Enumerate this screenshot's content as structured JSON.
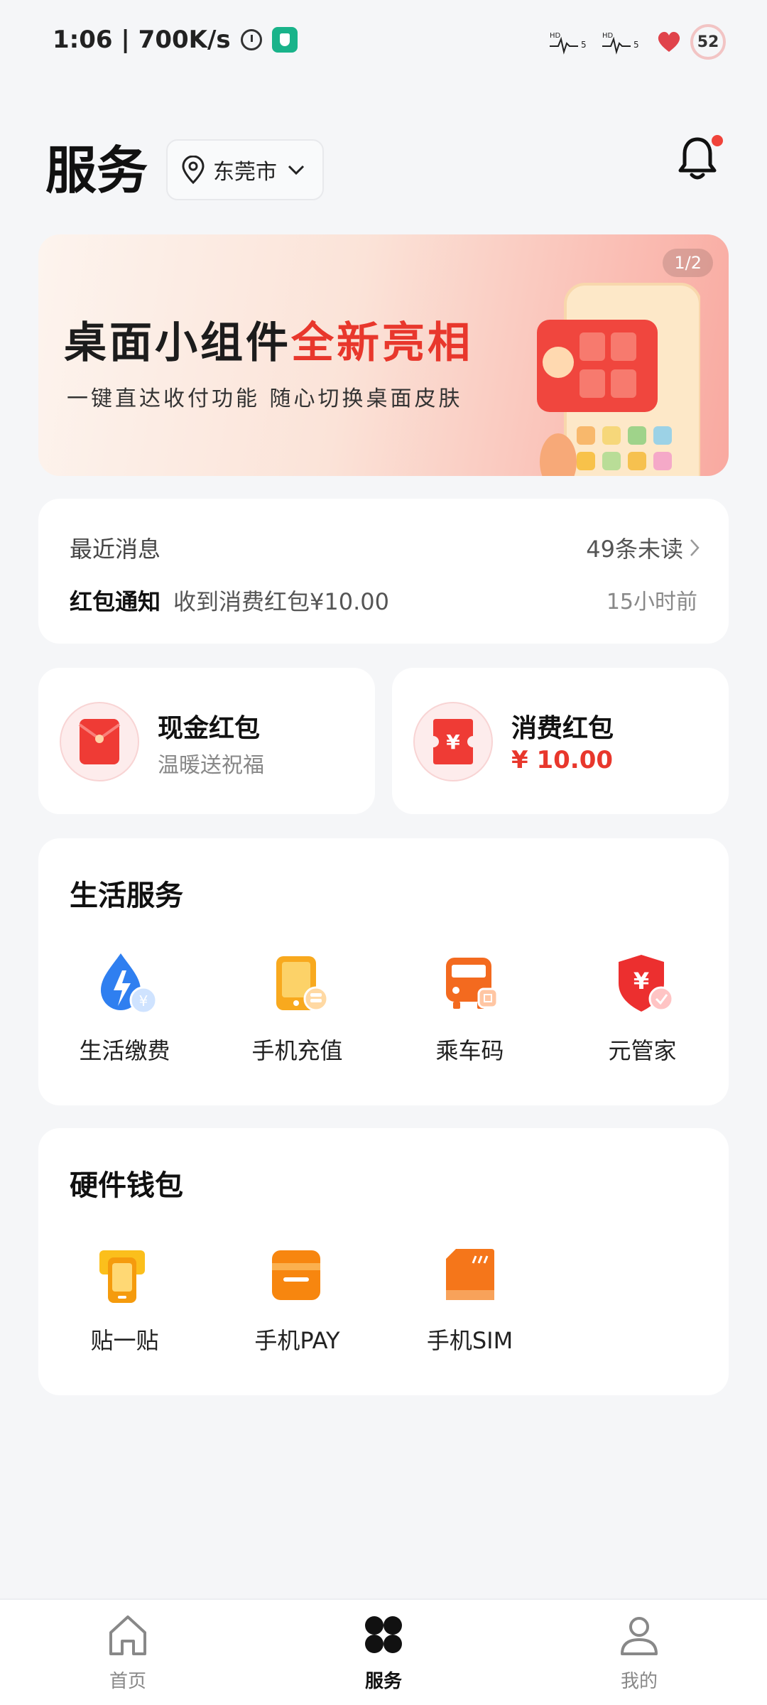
{
  "status_bar": {
    "time": "1:06 | 700K/s",
    "battery": "52",
    "icons": [
      "alarm-icon",
      "shield-app-icon",
      "signal-hd-icon",
      "heart-icon"
    ]
  },
  "header": {
    "title": "服务",
    "city": "东莞市"
  },
  "banner": {
    "page_indicator": "1/2",
    "title_part1": "桌面小组件",
    "title_part2": "全新亮相",
    "subtitle": "一键直达收付功能  随心切换桌面皮肤"
  },
  "messages": {
    "title": "最近消息",
    "unread": "49条未读",
    "type": "红包通知",
    "body": "收到消费红包¥10.00",
    "time": "15小时前"
  },
  "packets": {
    "cash": {
      "title": "现金红包",
      "subtitle": "温暖送祝福"
    },
    "consume": {
      "title": "消费红包",
      "amount": "¥ 10.00"
    }
  },
  "life_services": {
    "title": "生活服务",
    "items": [
      {
        "label": "生活缴费",
        "icon": "electricity-bill-icon"
      },
      {
        "label": "手机充值",
        "icon": "phone-recharge-icon"
      },
      {
        "label": "乘车码",
        "icon": "bus-code-icon"
      },
      {
        "label": "元管家",
        "icon": "wallet-shield-icon"
      }
    ]
  },
  "hardware_wallet": {
    "title": "硬件钱包",
    "items": [
      {
        "label": "贴一贴",
        "icon": "tap-pay-icon"
      },
      {
        "label": "手机PAY",
        "icon": "phone-pay-icon"
      },
      {
        "label": "手机SIM",
        "icon": "sim-card-icon"
      }
    ]
  },
  "bottom_nav": {
    "items": [
      {
        "label": "首页",
        "icon": "home-icon"
      },
      {
        "label": "服务",
        "icon": "services-grid-icon",
        "active": true
      },
      {
        "label": "我的",
        "icon": "profile-icon"
      }
    ]
  },
  "colors": {
    "accent_red": "#e8372c",
    "background": "#f5f6f8",
    "card": "#ffffff"
  }
}
